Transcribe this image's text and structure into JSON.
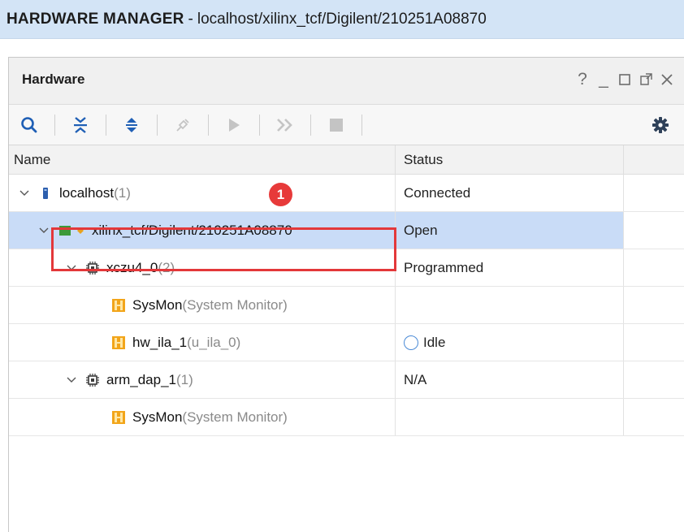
{
  "header": {
    "title": "HARDWARE MANAGER",
    "separator": "-",
    "path": "localhost/xilinx_tcf/Digilent/210251A08870"
  },
  "panel": {
    "title": "Hardware",
    "controls": {
      "help": "?",
      "minimize": "_",
      "maximize": "□",
      "restore": "⧉",
      "close": "✕"
    }
  },
  "toolbar": {
    "buttons": [
      "search-icon",
      "collapse-all-icon",
      "expand-all-icon",
      "auto-connect-icon",
      "run-icon",
      "run-immediate-icon",
      "stop-icon"
    ],
    "settings": "gear-icon"
  },
  "table": {
    "columns": [
      "Name",
      "Status"
    ],
    "rows": [
      {
        "name": "localhost",
        "extra": " (1)",
        "status": "Connected"
      },
      {
        "name": "xilinx_tcf/Digilent/210251A08870",
        "extra": "",
        "status": "Open",
        "selected": true
      },
      {
        "name": "xczu4_0",
        "extra": " (2)",
        "status": "Programmed"
      },
      {
        "name": "SysMon",
        "extra": " (System Monitor)",
        "status": ""
      },
      {
        "name": "hw_ila_1",
        "extra": " (u_ila_0)",
        "status": "Idle"
      },
      {
        "name": "arm_dap_1",
        "extra": " (1)",
        "status": "N/A"
      },
      {
        "name": "SysMon",
        "extra": " (System Monitor)",
        "status": ""
      }
    ]
  },
  "annotation": {
    "badge": "1"
  },
  "colors": {
    "header_bg": "#d3e4f6",
    "selected_row": "#c9dcf7",
    "highlight": "#e3383a",
    "badge": "#e73a3a"
  }
}
